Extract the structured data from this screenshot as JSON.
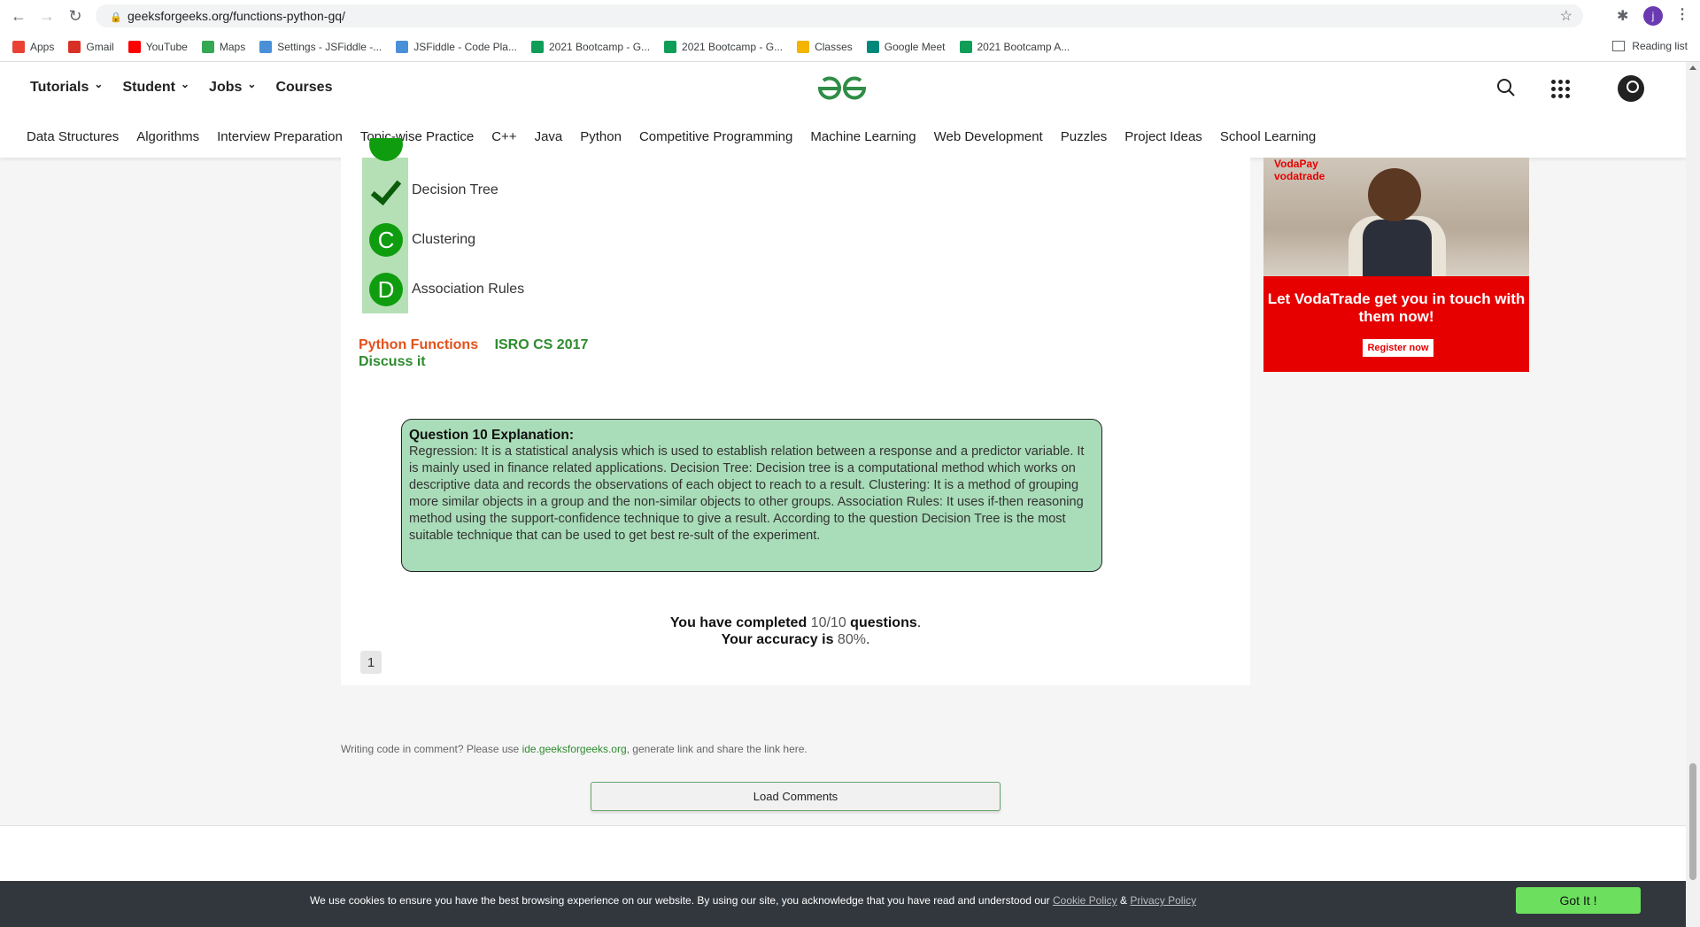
{
  "browser": {
    "url": "geeksforgeeks.org/functions-python-gq/",
    "profile_initial": "j",
    "bookmarks": [
      {
        "label": "Apps",
        "color": "#e94235"
      },
      {
        "label": "Gmail",
        "color": "#d93025"
      },
      {
        "label": "YouTube",
        "color": "#ff0000"
      },
      {
        "label": "Maps",
        "color": "#34a853"
      },
      {
        "label": "Settings - JSFiddle -...",
        "color": "#4a90d9"
      },
      {
        "label": "JSFiddle - Code Pla...",
        "color": "#4a90d9"
      },
      {
        "label": "2021 Bootcamp - G...",
        "color": "#0f9d58"
      },
      {
        "label": "2021 Bootcamp - G...",
        "color": "#0f9d58"
      },
      {
        "label": "Classes",
        "color": "#f4b400"
      },
      {
        "label": "Google Meet",
        "color": "#00897b"
      },
      {
        "label": "2021 Bootcamp A...",
        "color": "#0f9d58"
      }
    ],
    "reading_list": "Reading list"
  },
  "header": {
    "menu": [
      "Tutorials",
      "Student",
      "Jobs",
      "Courses"
    ],
    "logo_alt": "GfG"
  },
  "subnav": [
    "Data Structures",
    "Algorithms",
    "Interview Preparation",
    "Topic-wise Practice",
    "C++",
    "Java",
    "Python",
    "Competitive Programming",
    "Machine Learning",
    "Web Development",
    "Puzzles",
    "Project Ideas",
    "School Learning"
  ],
  "quiz": {
    "options": [
      {
        "letter": "✓",
        "label": "Decision Tree",
        "correct": true
      },
      {
        "letter": "C",
        "label": "Clustering",
        "correct": false
      },
      {
        "letter": "D",
        "label": "Association Rules",
        "correct": false
      }
    ],
    "tag_python": "Python Functions",
    "tag_isro": "ISRO CS 2017",
    "discuss": "Discuss it",
    "explanation_title": "Question 10 Explanation:",
    "explanation_text": "Regression: It is a statistical analysis which is used to establish relation between a response and a predictor variable. It is mainly used in finance related applications. Decision Tree: Decision tree is a computational method which works on descriptive data and records the observations of each object to reach to a result. Clustering: It is a method of grouping more similar objects in a group and the non-similar objects to other groups. Association Rules: It uses if-then reasoning method using the support-confidence technique to give a result. According to the question Decision Tree is the most suitable technique that can be used to get best re-sult of the experiment.",
    "completed_prefix": "You have completed",
    "completed_value": "10/10",
    "completed_suffix": "questions",
    "accuracy_prefix": "Your accuracy is",
    "accuracy_value": "80%",
    "page": "1"
  },
  "ad": {
    "brand_line1": "VodaPay",
    "brand_line2": "vodatrade",
    "headline": "Let VodaTrade get you in touch with them now!",
    "cta": "Register now"
  },
  "comments": {
    "note_prefix": "Writing code in comment? Please use",
    "note_link": "ide.geeksforgeeks.org",
    "note_suffix": ", generate link and share the link here.",
    "load_button": "Load Comments"
  },
  "cookie": {
    "text": "We use cookies to ensure you have the best browsing experience on our website. By using our site, you acknowledge that you have read and understood our",
    "policy_link": "Cookie Policy",
    "amp": "&",
    "privacy_link": "Privacy Policy",
    "button": "Got It !"
  }
}
